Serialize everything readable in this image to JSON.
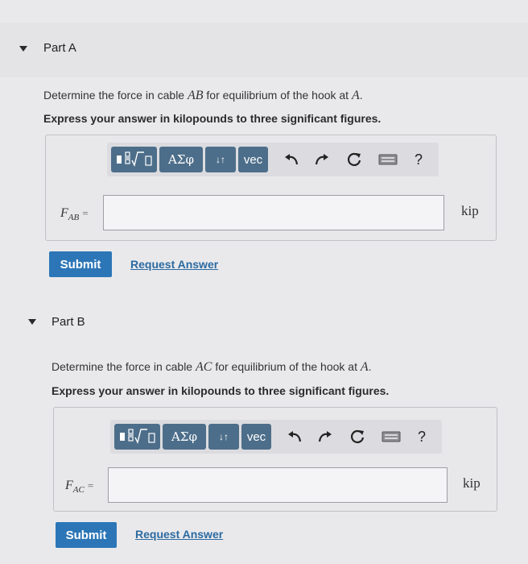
{
  "part_a": {
    "title": "Part A",
    "question_pre": "Determine the force in cable ",
    "question_math": "AB",
    "question_mid": " for equilibrium of the hook at ",
    "question_point": "A",
    "question_end": ".",
    "instruction": "Express your answer in kilopounds to three significant figures.",
    "var_main": "F",
    "var_sub": "AB",
    "equals": "=",
    "input_value": "",
    "unit": "kip",
    "submit_label": "Submit",
    "request_label": "Request Answer"
  },
  "part_b": {
    "title": "Part B",
    "question_pre": "Determine the force in cable ",
    "question_math": "AC",
    "question_mid": " for equilibrium of the hook at ",
    "question_point": "A",
    "question_end": ".",
    "instruction": "Express your answer in kilopounds to three significant figures.",
    "var_main": "F",
    "var_sub": "AC",
    "equals": "=",
    "input_value": "",
    "unit": "kip",
    "submit_label": "Submit",
    "request_label": "Request Answer"
  },
  "toolbar": {
    "greek_label": "ΑΣφ",
    "arrows_label": "↓↑",
    "vec_label": "vec",
    "help_label": "?"
  },
  "colors": {
    "toolbar_button": "#4d6e8a",
    "submit_button": "#2c76b7",
    "link": "#2c6aa0"
  }
}
